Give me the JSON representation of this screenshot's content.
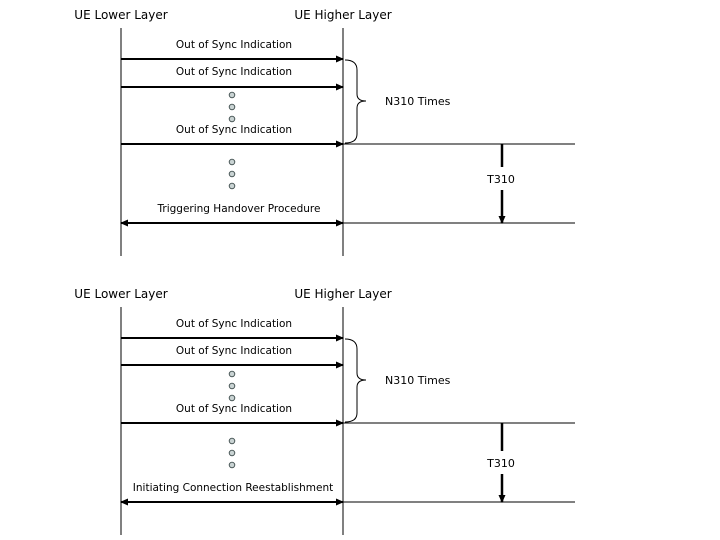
{
  "diagrams": [
    {
      "id": "handover",
      "left_lifeline": "UE Lower Layer",
      "right_lifeline": "UE Higher Layer",
      "messages": [
        "Out of Sync Indication",
        "Out of Sync Indication",
        "Out of Sync Indication"
      ],
      "brace_label": "N310 Times",
      "timer_label": "T310",
      "final_message": "Triggering Handover Procedure"
    },
    {
      "id": "reestablishment",
      "left_lifeline": "UE Lower Layer",
      "right_lifeline": "UE Higher Layer",
      "messages": [
        "Out of Sync Indication",
        "Out of Sync Indication",
        "Out of Sync Indication"
      ],
      "brace_label": "N310 Times",
      "timer_label": "T310",
      "final_message": "Initiating Connection Reestablishment"
    }
  ],
  "colors": {
    "line": "#000000",
    "dot_fill": "#c9d3d3",
    "dot_stroke": "#3c4a4a",
    "background": "#ffffff"
  }
}
